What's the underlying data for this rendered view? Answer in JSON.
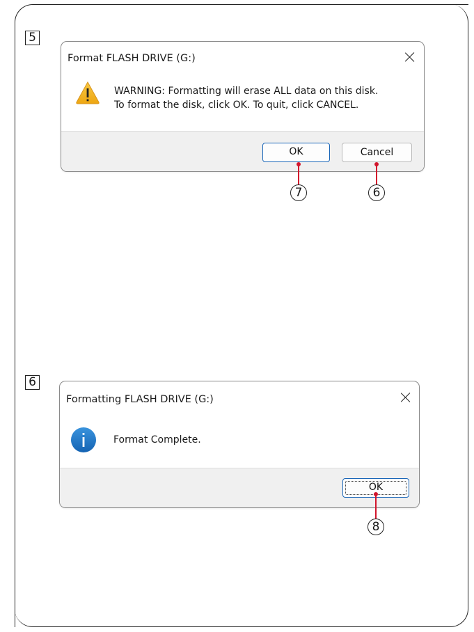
{
  "steps": {
    "step5": "5",
    "step6": "6"
  },
  "dialog_format": {
    "title": "Format FLASH DRIVE (G:)",
    "icon": "warning-icon",
    "message_line1": "WARNING: Formatting will erase ALL data on this disk.",
    "message_line2": "To format the disk, click OK. To quit, click CANCEL.",
    "ok_label": "OK",
    "cancel_label": "Cancel"
  },
  "dialog_complete": {
    "title": "Formatting FLASH DRIVE (G:)",
    "icon": "info-icon",
    "message": "Format Complete.",
    "ok_label": "OK"
  },
  "callouts": {
    "c7": "7",
    "c6": "6",
    "c8": "8"
  },
  "colors": {
    "callout": "#d2152c",
    "warning": "#f2b418",
    "info": "#1b77c8",
    "default_button_border": "#1a66b8"
  }
}
